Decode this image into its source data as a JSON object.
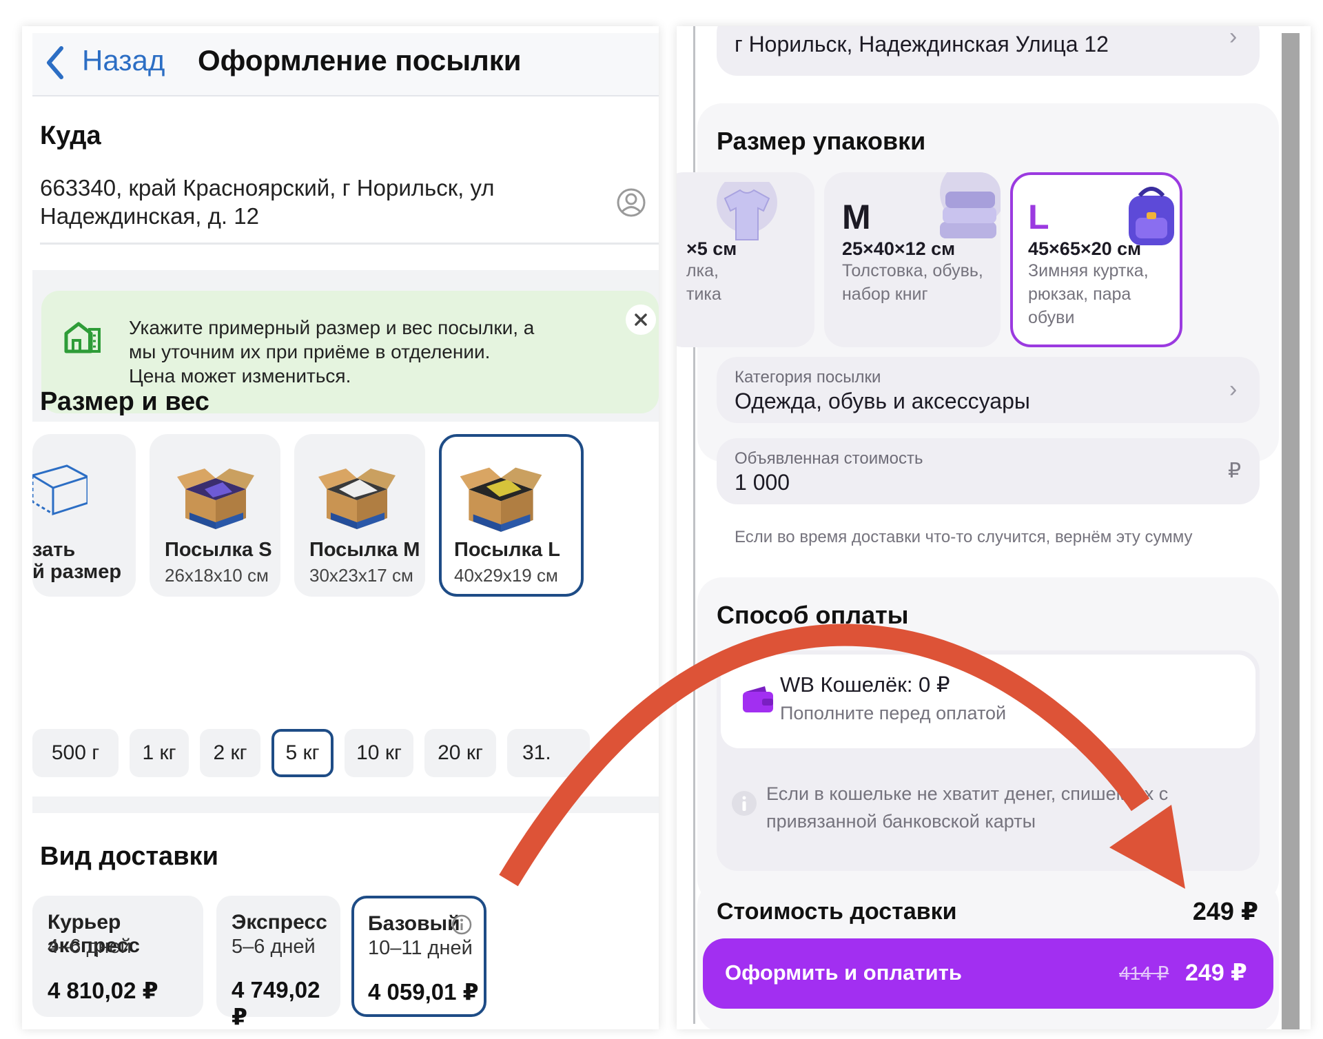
{
  "left": {
    "header": {
      "back_label": "Назад",
      "title": "Оформление посылки"
    },
    "destination": {
      "title": "Куда",
      "address_line1": "663340, край Красноярский, г Норильск, ул",
      "address_line2": "Надеждинская, д. 12"
    },
    "hint": {
      "line1": "Укажите примерный размер и вес посылки, а",
      "line2": "мы уточним их при приёме в отделении.",
      "line3": "Цена может измениться."
    },
    "size_section": {
      "title": "Размер и вес",
      "custom": {
        "line1": "зать",
        "line2": "й размер"
      },
      "parcels": [
        {
          "name": "Посылка S",
          "dims": "26х18х10 см"
        },
        {
          "name": "Посылка M",
          "dims": "30х23х17 см"
        },
        {
          "name": "Посылка L",
          "dims": "40х29х19 см"
        }
      ],
      "weights": [
        "500 г",
        "1 кг",
        "2 кг",
        "5 кг",
        "10 кг",
        "20 кг",
        "31."
      ],
      "selected_weight": "5 кг"
    },
    "delivery_section": {
      "title": "Вид доставки",
      "options": [
        {
          "name": "Курьер экспресс",
          "days": "4–6 дней",
          "price": "4 810,02 ₽"
        },
        {
          "name": "Экспресс",
          "days": "5–6 дней",
          "price": "4 749,02 ₽"
        },
        {
          "name": "Базовый",
          "days": "10–11 дней",
          "price": "4 059,01 ₽"
        }
      ]
    }
  },
  "right": {
    "address": "г Норильск, Надеждинская Улица 12",
    "package_section": {
      "title": "Размер упаковки",
      "cards": [
        {
          "letter": "",
          "dims": "×5 см",
          "desc1": "лка,",
          "desc2": "тика"
        },
        {
          "letter": "M",
          "dims": "25×40×12 см",
          "desc1": "Толстовка, обувь,",
          "desc2": "набор книг"
        },
        {
          "letter": "L",
          "dims": "45×65×20 см",
          "desc1": "Зимняя куртка,",
          "desc2": "рюкзак, пара обуви"
        }
      ]
    },
    "category": {
      "label": "Категория посылки",
      "value": "Одежда, обувь и аксессуары"
    },
    "declared": {
      "label": "Объявленная стоимость",
      "value": "1 000",
      "currency": "₽",
      "note": "Если во время доставки что-то случится, вернём эту сумму"
    },
    "payment": {
      "title": "Способ оплаты",
      "wallet_name": "WB Кошелёк: 0 ₽",
      "wallet_sub": "Пополните перед оплатой",
      "info_line1": "Если в кошельке не хватит денег, спишем их с",
      "info_line2": "привязанной банковской карты"
    },
    "cost": {
      "label": "Стоимость доставки",
      "value": "249 ₽"
    },
    "pay_button": {
      "label": "Оформить и оплатить",
      "old_price": "414 ₽",
      "price": "249 ₽"
    }
  },
  "colors": {
    "ios_link": "#2c6ec4",
    "selected_border": "#1e4c86",
    "hint_bg": "#e5f4df",
    "accent_purple": "#a22ff1",
    "arrow_red": "#dd5337"
  }
}
